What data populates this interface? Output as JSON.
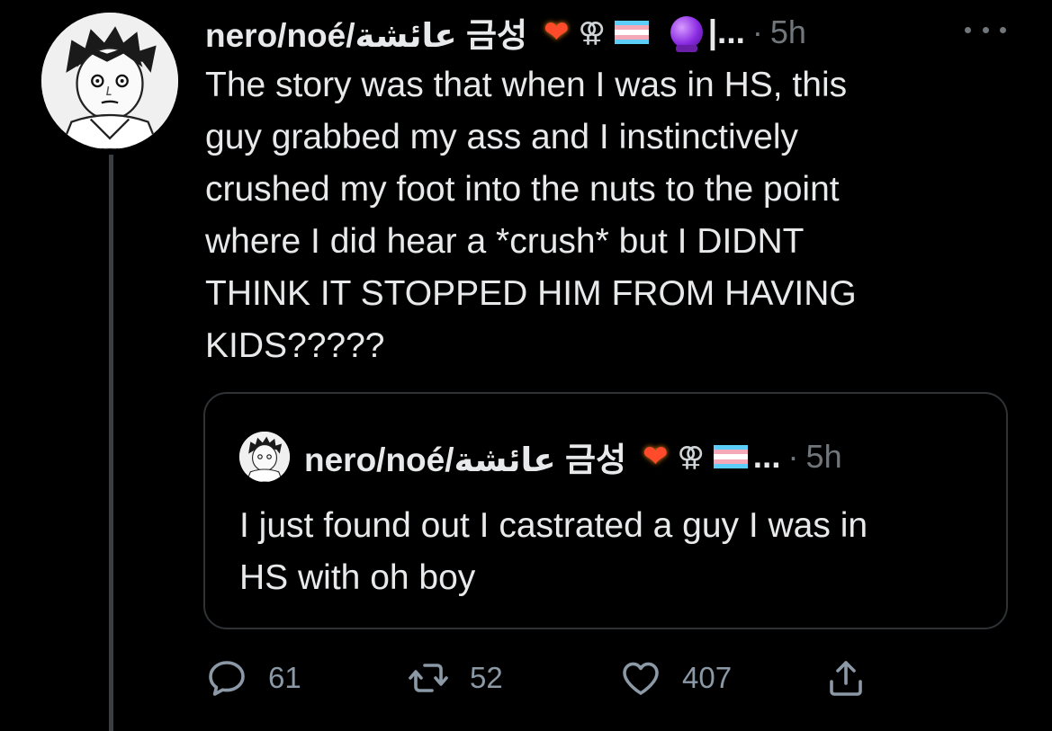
{
  "tweet": {
    "display_name": "nero/noé/عائشة 금성",
    "truncation": "|...",
    "separator": "·",
    "time": "5h",
    "text": "The story was that when I was in HS, this\nguy grabbed my ass and I instinctively\ncrushed my foot into the nuts to the point\nwhere I did hear a *crush* but I DIDNT\nTHINK IT STOPPED HIM FROM HAVING\nKIDS?????"
  },
  "badges": {
    "heart_icon": "heart-on-fire-icon",
    "venus_symbol": "⚢",
    "flag_icon": "transgender-flag-icon",
    "flag_colors": [
      "#5bcefa",
      "#f5a9b8",
      "#ffffff",
      "#f5a9b8",
      "#5bcefa"
    ],
    "crystal_icon": "crystal-ball-icon"
  },
  "quoted": {
    "display_name": "nero/noé/عائشة 금성",
    "truncation": "...",
    "separator": "·",
    "time": "5h",
    "text": "I just found out I castrated a guy I was in\nHS with oh boy"
  },
  "actions": {
    "reply_count": "61",
    "retweet_count": "52",
    "like_count": "407"
  },
  "colors": {
    "background": "#000000",
    "text": "#e7e9ea",
    "muted": "#71767b",
    "border": "#2f3336"
  }
}
